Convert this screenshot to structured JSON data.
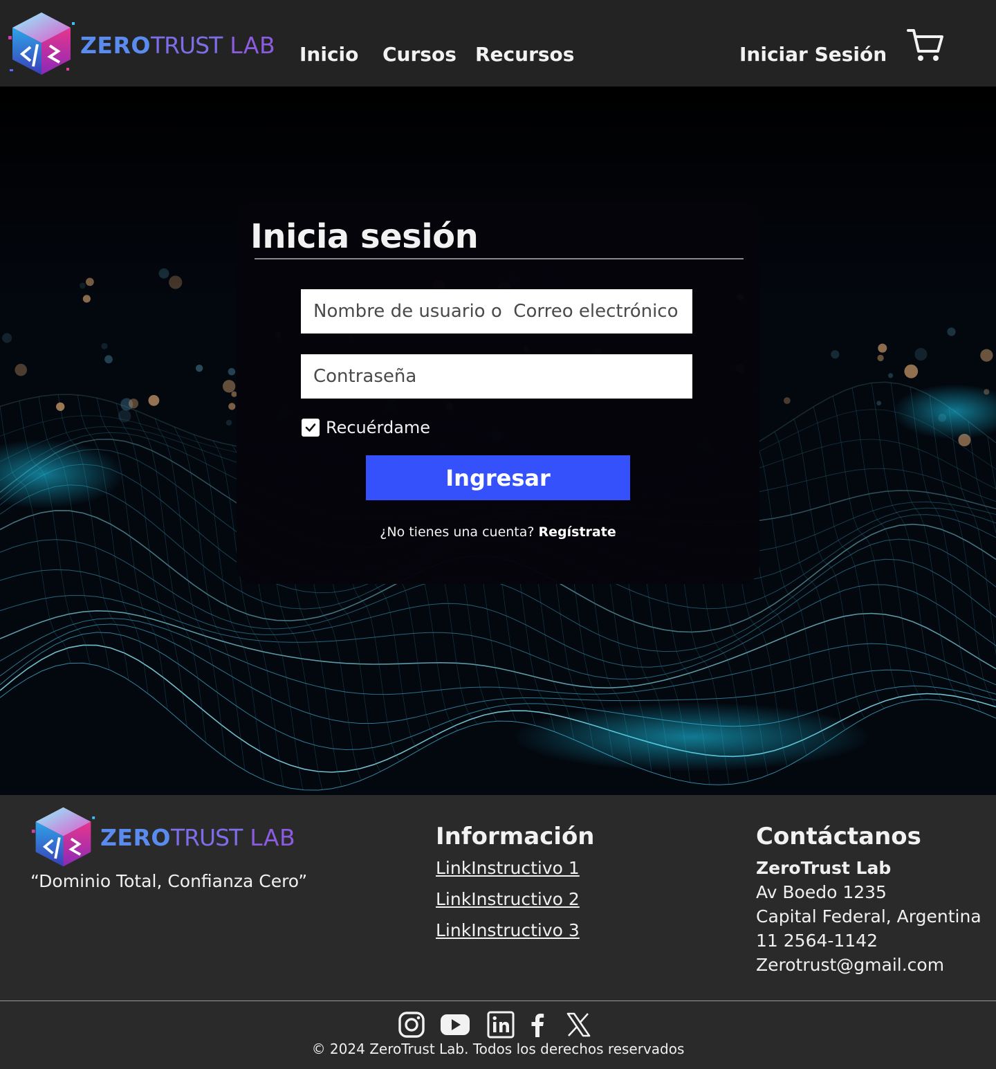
{
  "brand": {
    "name_part1": "ZERO",
    "name_part2": "TRUST",
    "name_part3": " LAB"
  },
  "nav": {
    "inicio": "Inicio",
    "cursos": "Cursos",
    "recursos": "Recursos",
    "login": "Iniciar Sesión"
  },
  "icons": {
    "cart": "cart-icon",
    "checkbox": "checkmark-icon",
    "social": [
      "instagram-icon",
      "youtube-icon",
      "linkedin-icon",
      "facebook-icon",
      "x-icon"
    ]
  },
  "login_form": {
    "title": "Inicia sesión",
    "username_placeholder": "Nombre de usuario o  Correo electrónico",
    "password_placeholder": "Contraseña",
    "remember_label": "Recuérdame",
    "remember_checked": true,
    "submit_label": "Ingresar",
    "signup_prompt": "¿No tienes una cuenta?",
    "signup_link": "Regístrate"
  },
  "footer": {
    "slogan": "“Dominio Total, Confianza Cero”",
    "info_title": "Información",
    "info_links": [
      "LinkInstructivo 1",
      "LinkInstructivo 2",
      "LinkInstructivo 3"
    ],
    "contact_title": "Contáctanos",
    "contact": {
      "name": "ZeroTrust Lab",
      "address": "Av Boedo 1235",
      "city": "Capital Federal, Argentina",
      "phone": "11 2564-1142",
      "email": "Zerotrust@gmail.com"
    },
    "copyright": "© 2024 ZeroTrust Lab. Todos los derechos reservados"
  },
  "colors": {
    "header_bg": "#232323",
    "footer_bg": "#2a2a2a",
    "button_blue": "#3551fb",
    "brand_blue": "#5a8cf0",
    "brand_purple": "#8c5ce0",
    "wave_cyan": "#3fd0f0"
  }
}
